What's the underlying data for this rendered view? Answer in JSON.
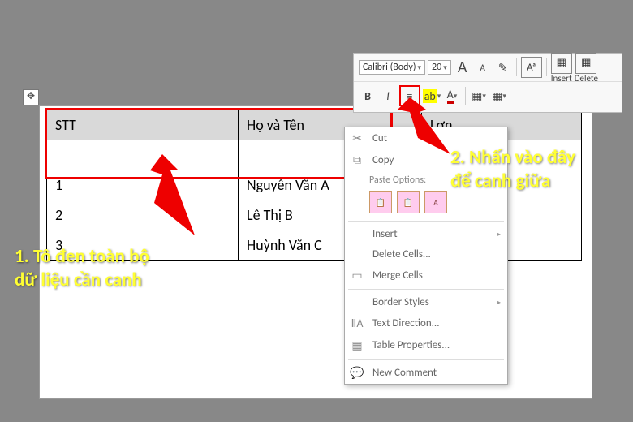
{
  "move_handle": "✥",
  "table": {
    "headers": [
      "STT",
      "Họ và Tên",
      "Lợn"
    ],
    "rows": [
      [
        "1",
        "Nguyễn Văn A",
        ""
      ],
      [
        "2",
        "Lê Thị B",
        ""
      ],
      [
        "3",
        "Huỳnh Văn C",
        ""
      ]
    ]
  },
  "mini_toolbar": {
    "font_name": "Calibri (Body)",
    "font_size": "20",
    "grow": "A",
    "shrink": "A",
    "painter": "✎",
    "bold": "B",
    "italic": "I",
    "center_lines": "≡",
    "highlight": "ab",
    "font_color": "A",
    "insert": "Insert",
    "delete": "Delete"
  },
  "context_menu": {
    "cut": "Cut",
    "copy": "Copy",
    "paste_head": "Paste Options:",
    "paste_icons": [
      "📋",
      "📋",
      "A"
    ],
    "insert": "Insert",
    "delete_cells": "Delete Cells...",
    "merge": "Merge Cells",
    "borders": "Border Styles",
    "text_dir": "Text Direction...",
    "table_props": "Table Properties...",
    "new_comment": "New Comment"
  },
  "annotations": {
    "step1": "1. Tô đen toàn bộ\ndữ liệu cần canh",
    "step2": "2. Nhấn vào đây\nđể canh giữa"
  }
}
